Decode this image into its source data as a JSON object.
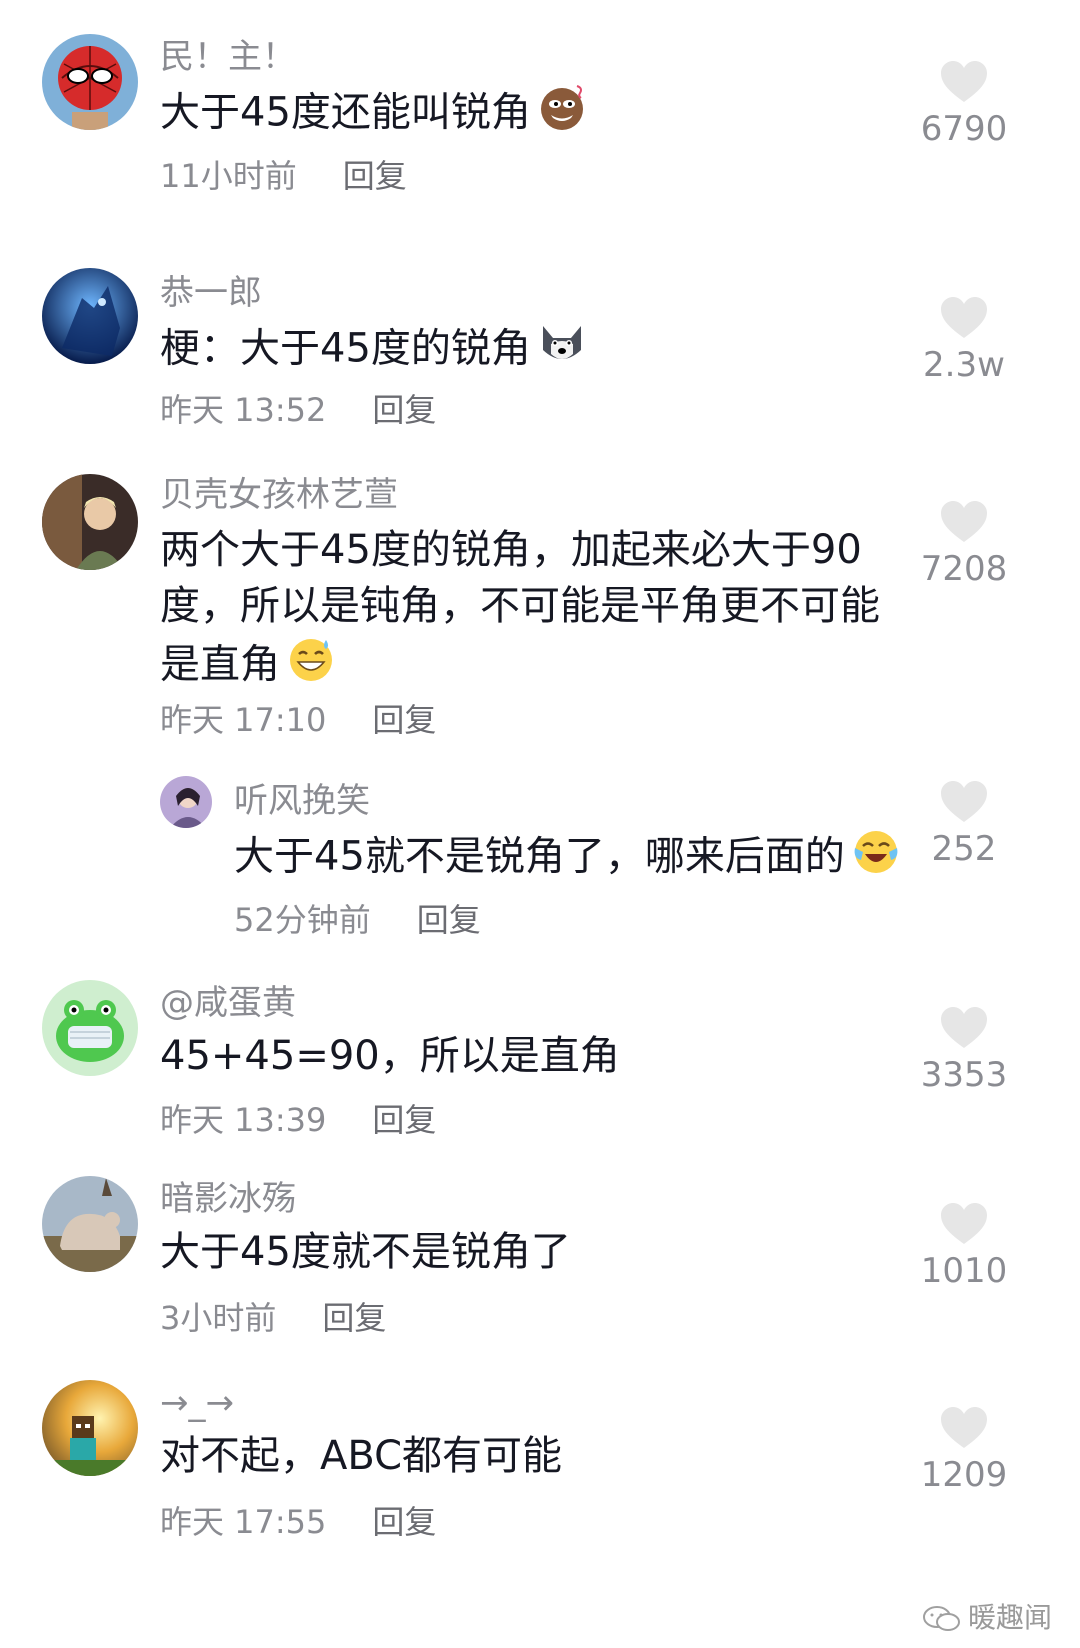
{
  "comments": [
    {
      "username": "民！主！",
      "text": "大于45度还能叫锐角",
      "time": "11小时前",
      "reply": "回复",
      "likes": "6790",
      "emoji": "smirk-emoji"
    },
    {
      "username": "恭一郎",
      "text": "梗：大于45度的锐角",
      "time": "昨天 13:52",
      "reply": "回复",
      "likes": "2.3w",
      "emoji": "husky-emoji"
    },
    {
      "username": "贝壳女孩林艺萱",
      "text": "两个大于45度的锐角，加起来必大于90度，所以是钝角，不可能是平角更不可能是直角",
      "time": "昨天 17:10",
      "reply": "回复",
      "likes": "7208",
      "emoji": "grin-sweat-emoji"
    },
    {
      "username": "听风挽笑",
      "text": "大于45就不是锐角了，哪来后面的",
      "time": "52分钟前",
      "reply": "回复",
      "likes": "252",
      "emoji": "laugh-cry-emoji"
    },
    {
      "username": "@咸蛋黄",
      "text": "45+45=90，所以是直角",
      "time": "昨天 13:39",
      "reply": "回复",
      "likes": "3353"
    },
    {
      "username": "暗影冰殇",
      "text": "大于45度就不是锐角了",
      "time": "3小时前",
      "reply": "回复",
      "likes": "1010"
    },
    {
      "username": "→_→",
      "text": "对不起，ABC都有可能",
      "time": "昨天 17:55",
      "reply": "回复",
      "likes": "1209"
    }
  ],
  "watermark": "暖趣闻",
  "colors": {
    "text": "#161823",
    "secondary": "#8a8b91",
    "heart": "#e6e6e6"
  }
}
